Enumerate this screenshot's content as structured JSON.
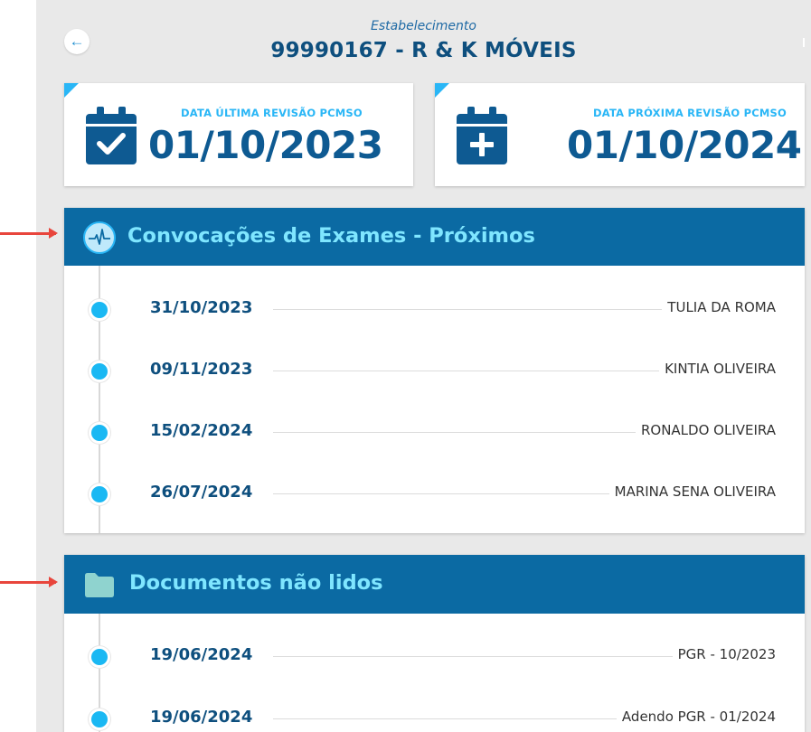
{
  "header": {
    "back_icon": "arrow-left-icon",
    "establishment_label": "Estabelecimento",
    "establishment_title": "99990167 - R & K MÓVEIS"
  },
  "cards": [
    {
      "label": "DATA ÚLTIMA REVISÃO PCMSO",
      "date": "01/10/2023",
      "icon": "calendar-check-icon"
    },
    {
      "label": "DATA PRÓXIMA REVISÃO PCMSO",
      "date": "01/10/2024",
      "icon": "calendar-plus-icon"
    }
  ],
  "panels": {
    "exams": {
      "title": "Convocações de Exames - Próximos",
      "icon": "heartbeat-icon",
      "items": [
        {
          "date": "31/10/2023",
          "name": "TULIA DA ROMA"
        },
        {
          "date": "09/11/2023",
          "name": "KINTIA OLIVEIRA"
        },
        {
          "date": "15/02/2024",
          "name": "RONALDO OLIVEIRA"
        },
        {
          "date": "26/07/2024",
          "name": "MARINA SENA OLIVEIRA"
        }
      ]
    },
    "documents": {
      "title": "Documentos não lidos",
      "icon": "folder-icon",
      "items": [
        {
          "date": "19/06/2024",
          "name": "PGR - 10/2023"
        },
        {
          "date": "19/06/2024",
          "name": "Adendo PGR - 01/2024"
        }
      ]
    }
  },
  "colors": {
    "panel_header": "#0b6aa3",
    "panel_title": "#7fe6ff",
    "accent": "#29b6f6",
    "date_text": "#0e4f7e",
    "annotation_arrow": "#e8453c"
  }
}
